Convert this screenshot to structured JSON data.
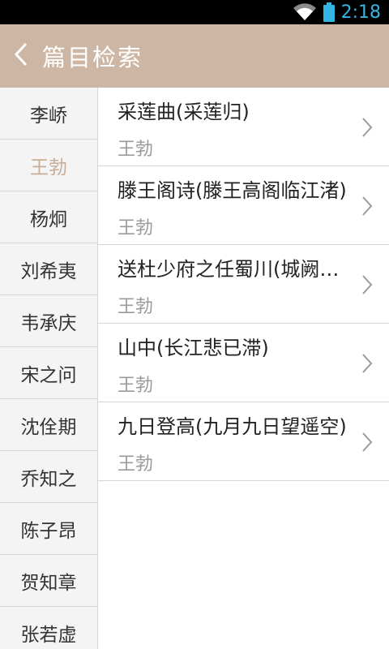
{
  "status_bar": {
    "time": "2:18",
    "wifi_icon": "wifi-icon",
    "battery_icon": "battery-icon"
  },
  "header": {
    "title": "篇目检索",
    "back_icon": "chevron-left-icon",
    "bg_color": "#cdb6a3"
  },
  "sidebar": {
    "items": [
      {
        "label": "李峤"
      },
      {
        "label": "王勃",
        "active": true
      },
      {
        "label": "杨炯"
      },
      {
        "label": "刘希夷"
      },
      {
        "label": "韦承庆"
      },
      {
        "label": "宋之问"
      },
      {
        "label": "沈佺期"
      },
      {
        "label": "乔知之"
      },
      {
        "label": "陈子昂"
      },
      {
        "label": "贺知章"
      },
      {
        "label": "张若虚"
      }
    ],
    "active_color": "#c8ad97"
  },
  "poems": [
    {
      "title": "采莲曲(采莲归)",
      "author": "王勃"
    },
    {
      "title": "滕王阁诗(滕王高阁临江渚)",
      "author": "王勃"
    },
    {
      "title": "送杜少府之任蜀川(城阙辅三秦)",
      "author": "王勃"
    },
    {
      "title": "山中(长江悲已滞)",
      "author": "王勃"
    },
    {
      "title": "九日登高(九月九日望遥空)",
      "author": "王勃"
    }
  ]
}
